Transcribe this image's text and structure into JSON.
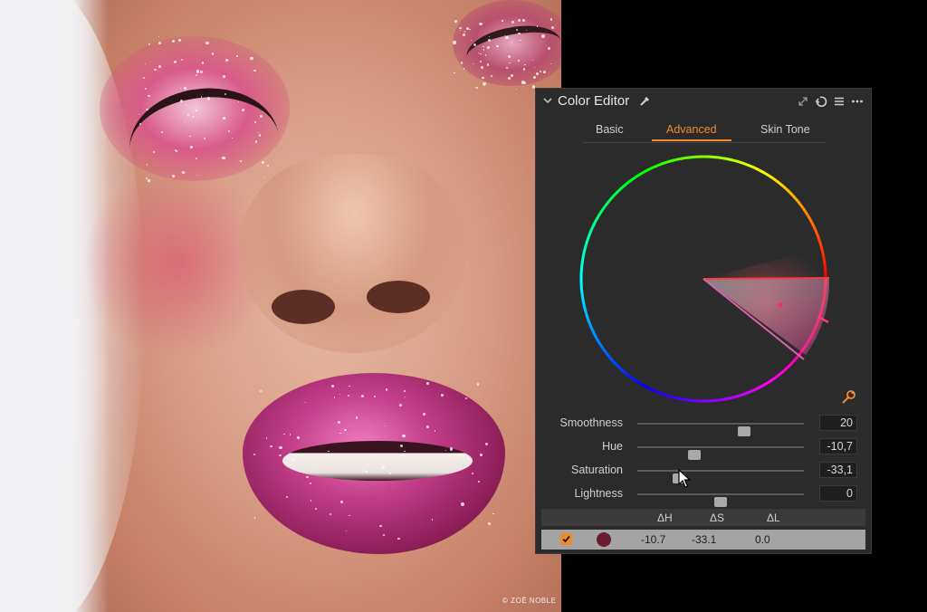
{
  "photo": {
    "credit": "© ZOË NOBLE"
  },
  "panel": {
    "title": "Color Editor",
    "tabs": [
      {
        "label": "Basic",
        "active": false
      },
      {
        "label": "Advanced",
        "active": true
      },
      {
        "label": "Skin Tone",
        "active": false
      }
    ],
    "sliders": [
      {
        "label": "Smoothness",
        "value": "20",
        "position": 0.64
      },
      {
        "label": "Hue",
        "value": "-10,7",
        "position": 0.34
      },
      {
        "label": "Saturation",
        "value": "-33,1",
        "position": 0.25
      },
      {
        "label": "Lightness",
        "value": "0",
        "position": 0.5
      }
    ],
    "table": {
      "headers": [
        "ΔH",
        "ΔS",
        "ΔL"
      ],
      "row": {
        "checked": true,
        "swatch_color": "#6a1c33",
        "dh": "-10.7",
        "ds": "-33.1",
        "dl": "0.0"
      }
    },
    "accent_color": "#ef8a2e"
  }
}
